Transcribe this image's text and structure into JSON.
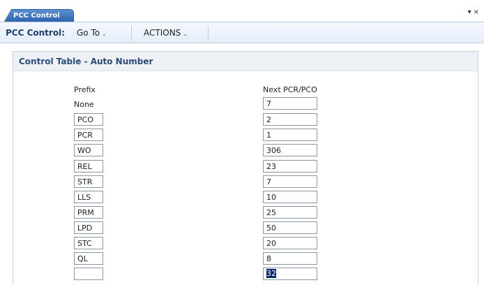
{
  "tab": {
    "label": "PCC Control"
  },
  "window_controls": {
    "menu": "▾",
    "close": "×"
  },
  "toolbar": {
    "title": "PCC Control:",
    "goto_label": "Go To",
    "actions_label": "ACTIONS",
    "caret": "⌄"
  },
  "panel": {
    "title": "Control Table - Auto Number"
  },
  "table": {
    "prefix_header": "Prefix",
    "next_header": "Next PCR/PCO",
    "none_label": "None",
    "none_next": "7",
    "rows": [
      {
        "prefix": "PCO",
        "next": "2"
      },
      {
        "prefix": "PCR",
        "next": "1"
      },
      {
        "prefix": "WO",
        "next": "306"
      },
      {
        "prefix": "REL",
        "next": "23"
      },
      {
        "prefix": "STR",
        "next": "7"
      },
      {
        "prefix": "LLS",
        "next": "10"
      },
      {
        "prefix": "PRM",
        "next": "25"
      },
      {
        "prefix": "LPD",
        "next": "50"
      },
      {
        "prefix": "STC",
        "next": "20"
      },
      {
        "prefix": "QL",
        "next": "8"
      },
      {
        "prefix": "",
        "next": "32"
      }
    ]
  }
}
